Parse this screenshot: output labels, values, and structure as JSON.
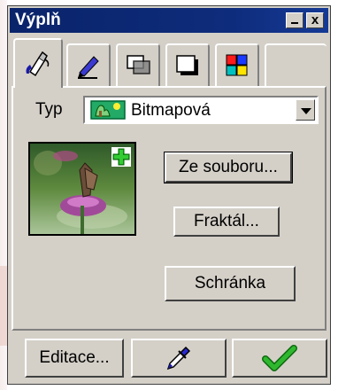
{
  "window": {
    "title": "Výplň",
    "minimize_label": "_",
    "close_label": "x"
  },
  "tabs": [
    {
      "name": "fill-bucket-icon",
      "active": true
    },
    {
      "name": "pen-icon",
      "active": false
    },
    {
      "name": "transparency-icon",
      "active": false
    },
    {
      "name": "shadow-icon",
      "active": false
    },
    {
      "name": "color-grid-icon",
      "active": false
    }
  ],
  "fill_type": {
    "label": "Typ",
    "selected": "Bitmapová",
    "icon": "bitmap-icon"
  },
  "preview": {
    "image": "butterfly-on-flower",
    "badge_icon": "plus-icon"
  },
  "buttons": {
    "from_file": "Ze souboru...",
    "fractal": "Fraktál...",
    "clipboard": "Schránka",
    "edit": "Editace...",
    "eyedropper_icon": "eyedropper-icon",
    "apply_icon": "checkmark-icon"
  },
  "colors": {
    "title_bar": "#0a246a",
    "face": "#d4d0c8",
    "check_green": "#1f9a1f",
    "plus_green": "#22aa22"
  }
}
